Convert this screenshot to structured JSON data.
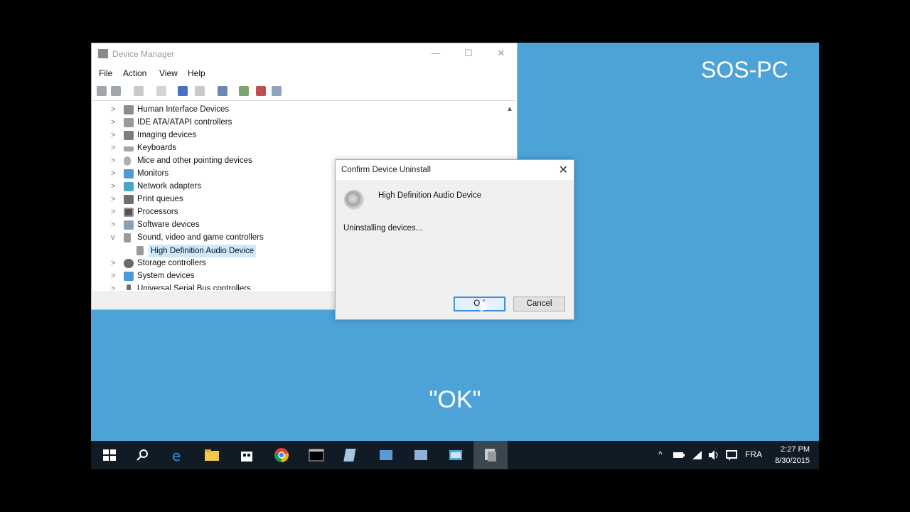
{
  "desktop": {
    "brand": "SOS-PC",
    "caption": "\"OK\""
  },
  "device_manager": {
    "title": "Device Manager",
    "window_buttons": {
      "minimize": "—",
      "maximize": "☐",
      "close": "✕"
    },
    "menu": [
      "File",
      "Action",
      "View",
      "Help"
    ],
    "tree": [
      {
        "label": "Human Interface Devices",
        "chev": ">"
      },
      {
        "label": "IDE ATA/ATAPI controllers",
        "chev": ">"
      },
      {
        "label": "Imaging devices",
        "chev": ">"
      },
      {
        "label": "Keyboards",
        "chev": ">"
      },
      {
        "label": "Mice and other pointing devices",
        "chev": ">"
      },
      {
        "label": "Monitors",
        "chev": ">"
      },
      {
        "label": "Network adapters",
        "chev": ">"
      },
      {
        "label": "Print queues",
        "chev": ">"
      },
      {
        "label": "Processors",
        "chev": ">"
      },
      {
        "label": "Software devices",
        "chev": ">"
      },
      {
        "label": "Sound, video and game controllers",
        "chev": "v"
      },
      {
        "label": "High Definition Audio Device",
        "chev": ""
      },
      {
        "label": "Storage controllers",
        "chev": ">"
      },
      {
        "label": "System devices",
        "chev": ">"
      },
      {
        "label": "Universal Serial Bus controllers",
        "chev": ">"
      }
    ],
    "scroll_up": "▲"
  },
  "dialog": {
    "title": "Confirm Device Uninstall",
    "close": "✕",
    "device": "High Definition Audio Device",
    "status": "Uninstalling devices...",
    "ok": "OK",
    "cancel": "Cancel"
  },
  "taskbar": {
    "language": "FRA",
    "time": "2:27 PM",
    "date": "8/30/2015",
    "tray_chevron": "^",
    "colors": {
      "taskbar": "#101b26",
      "desktop": "#4da3d8"
    }
  }
}
